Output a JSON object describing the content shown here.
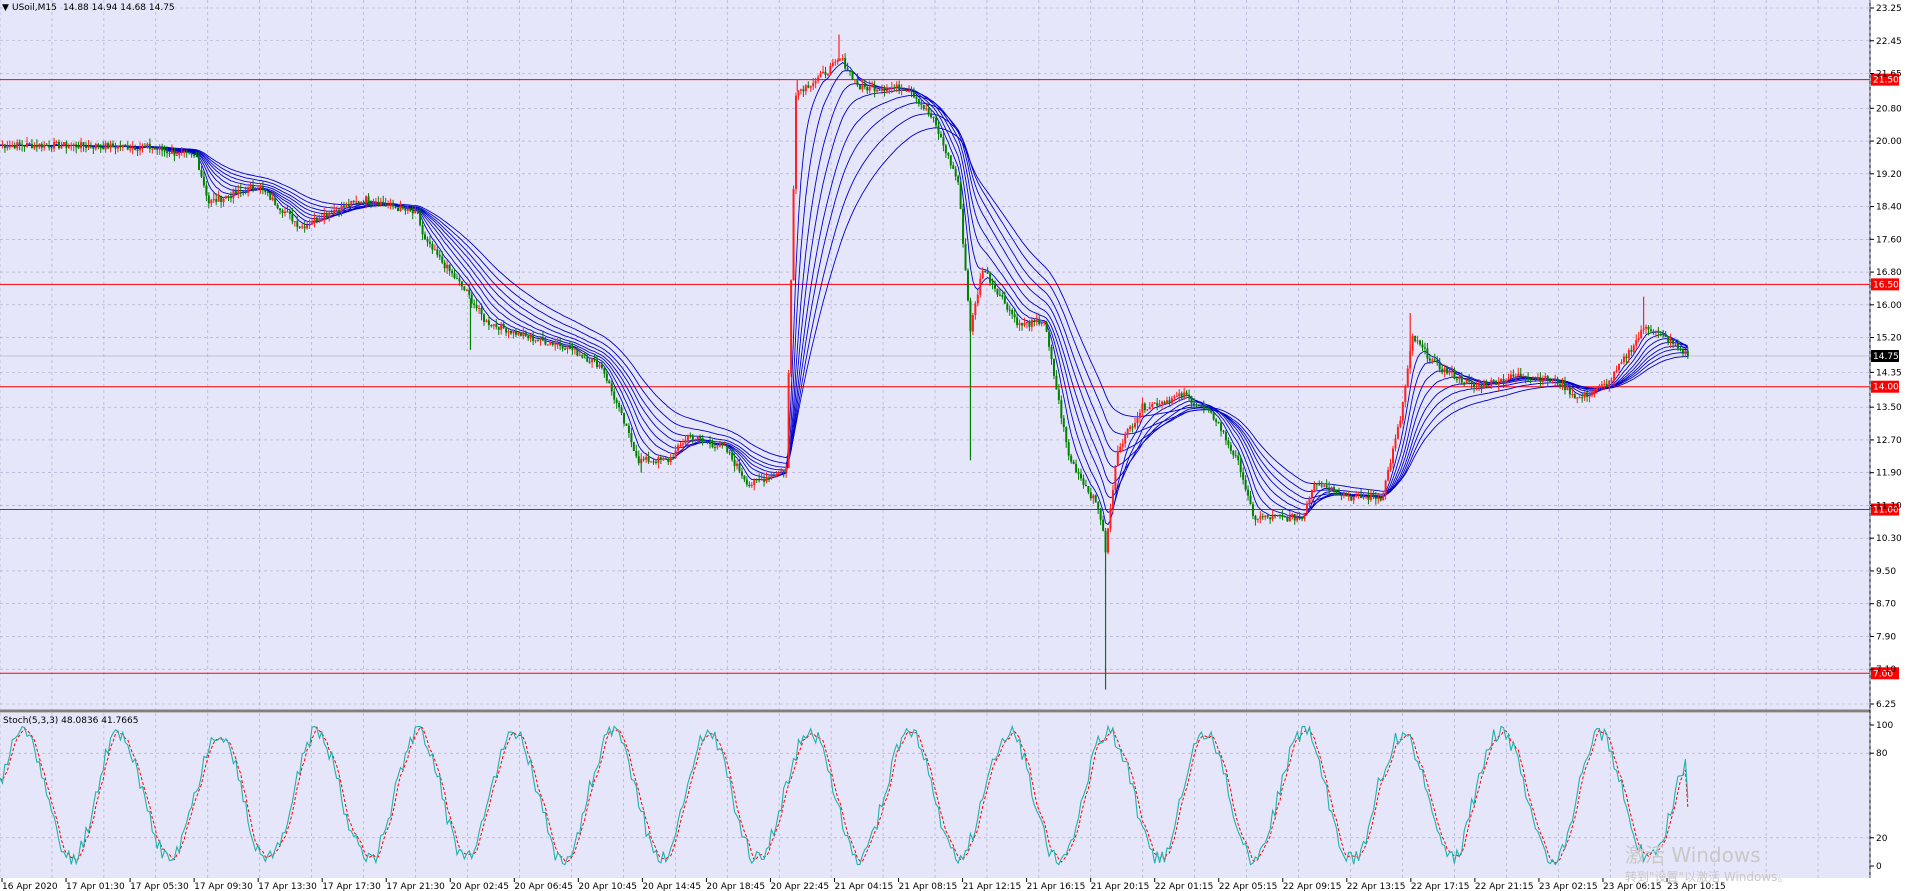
{
  "header": {
    "symbol_label": "USoil,M15",
    "ohlc_label": "14.88 14.94 14.68 14.75"
  },
  "sub_header": {
    "indicator_label": "Stoch(5,3,3) 48.0836 41.7665"
  },
  "watermark": {
    "text": "激活 Windows",
    "subtext": "转到\"设置\"以激活 Windows。"
  },
  "colors": {
    "background": "#e6e6fa",
    "grid": "#a6a6c8",
    "ma_ribbon": "#0000cd",
    "level_line": "#ff0000",
    "bull_candle": "#ff2020",
    "bear_candle": "#008000",
    "stoch_main": "#20b2aa",
    "stoch_signal": "#ff0000"
  },
  "chart_data": [
    {
      "type": "line",
      "name": "price",
      "ylim": [
        6.25,
        23.25
      ],
      "y_ticks": [
        "23.25",
        "22.45",
        "21.65",
        "20.80",
        "20.00",
        "19.20",
        "18.40",
        "17.60",
        "16.80",
        "16.00",
        "15.20",
        "14.35",
        "13.50",
        "12.70",
        "11.90",
        "11.10",
        "10.30",
        "9.50",
        "8.70",
        "7.90",
        "7.10",
        "6.25"
      ],
      "x_tick_labels": [
        "16 Apr 2020",
        "17 Apr 01:30",
        "17 Apr 05:30",
        "17 Apr 09:30",
        "17 Apr 13:30",
        "17 Apr 17:30",
        "17 Apr 21:30",
        "20 Apr 02:45",
        "20 Apr 06:45",
        "20 Apr 10:45",
        "20 Apr 14:45",
        "20 Apr 18:45",
        "20 Apr 22:45",
        "21 Apr 04:15",
        "21 Apr 08:15",
        "21 Apr 12:15",
        "21 Apr 16:15",
        "21 Apr 20:15",
        "22 Apr 01:15",
        "22 Apr 05:15",
        "22 Apr 09:15",
        "22 Apr 13:15",
        "22 Apr 17:15",
        "22 Apr 21:15",
        "23 Apr 02:15",
        "23 Apr 06:15",
        "23 Apr 10:15"
      ],
      "horizontal_levels": [
        21.5,
        16.5,
        14.0,
        11.0,
        7.0
      ],
      "current_price": 14.75,
      "price_path": [
        {
          "t": 0,
          "v": 19.9
        },
        {
          "t": 40,
          "v": 19.9
        },
        {
          "t": 120,
          "v": 19.85
        },
        {
          "t": 160,
          "v": 19.6
        },
        {
          "t": 170,
          "v": 18.5
        },
        {
          "t": 210,
          "v": 18.9
        },
        {
          "t": 245,
          "v": 17.9
        },
        {
          "t": 270,
          "v": 18.3
        },
        {
          "t": 300,
          "v": 18.6
        },
        {
          "t": 340,
          "v": 18.2
        },
        {
          "t": 345,
          "v": 17.6
        },
        {
          "t": 380,
          "v": 16.3
        },
        {
          "t": 395,
          "v": 15.6
        },
        {
          "t": 430,
          "v": 15.2
        },
        {
          "t": 460,
          "v": 15.0
        },
        {
          "t": 490,
          "v": 14.5
        },
        {
          "t": 520,
          "v": 12.2
        },
        {
          "t": 545,
          "v": 12.2
        },
        {
          "t": 560,
          "v": 12.8
        },
        {
          "t": 590,
          "v": 12.5
        },
        {
          "t": 610,
          "v": 11.6
        },
        {
          "t": 640,
          "v": 12.0
        },
        {
          "t": 648,
          "v": 21.2
        },
        {
          "t": 665,
          "v": 21.5
        },
        {
          "t": 685,
          "v": 22.0
        },
        {
          "t": 700,
          "v": 21.3
        },
        {
          "t": 740,
          "v": 21.3
        },
        {
          "t": 760,
          "v": 20.5
        },
        {
          "t": 780,
          "v": 19.0
        },
        {
          "t": 790,
          "v": 15.4
        },
        {
          "t": 800,
          "v": 16.9
        },
        {
          "t": 830,
          "v": 15.5
        },
        {
          "t": 850,
          "v": 15.6
        },
        {
          "t": 870,
          "v": 12.3
        },
        {
          "t": 895,
          "v": 11.0
        },
        {
          "t": 900,
          "v": 10.0
        },
        {
          "t": 910,
          "v": 12.5
        },
        {
          "t": 930,
          "v": 13.5
        },
        {
          "t": 965,
          "v": 13.8
        },
        {
          "t": 990,
          "v": 13.2
        },
        {
          "t": 1010,
          "v": 12.0
        },
        {
          "t": 1020,
          "v": 10.8
        },
        {
          "t": 1060,
          "v": 10.8
        },
        {
          "t": 1070,
          "v": 11.7
        },
        {
          "t": 1100,
          "v": 11.3
        },
        {
          "t": 1125,
          "v": 11.3
        },
        {
          "t": 1140,
          "v": 13.2
        },
        {
          "t": 1150,
          "v": 15.2
        },
        {
          "t": 1170,
          "v": 14.5
        },
        {
          "t": 1200,
          "v": 14.0
        },
        {
          "t": 1240,
          "v": 14.3
        },
        {
          "t": 1270,
          "v": 14.1
        },
        {
          "t": 1285,
          "v": 13.7
        },
        {
          "t": 1310,
          "v": 14.1
        },
        {
          "t": 1340,
          "v": 15.5
        },
        {
          "t": 1355,
          "v": 15.2
        },
        {
          "t": 1375,
          "v": 14.75
        }
      ],
      "spikes": [
        {
          "t": 383,
          "low": 14.9
        },
        {
          "t": 522,
          "low": 11.9
        },
        {
          "t": 649,
          "high": 21.5
        },
        {
          "t": 683,
          "high": 22.6
        },
        {
          "t": 790,
          "low": 12.2
        },
        {
          "t": 900,
          "low": 6.6
        },
        {
          "t": 1148,
          "high": 15.8
        },
        {
          "t": 1338,
          "high": 16.2
        }
      ]
    },
    {
      "type": "line",
      "name": "Stoch(5,3,3)",
      "ylim": [
        0,
        100
      ],
      "y_ticks": [
        "100",
        "80",
        "20",
        "0"
      ],
      "main_last": 48.0836,
      "signal_last": 41.7665
    }
  ]
}
